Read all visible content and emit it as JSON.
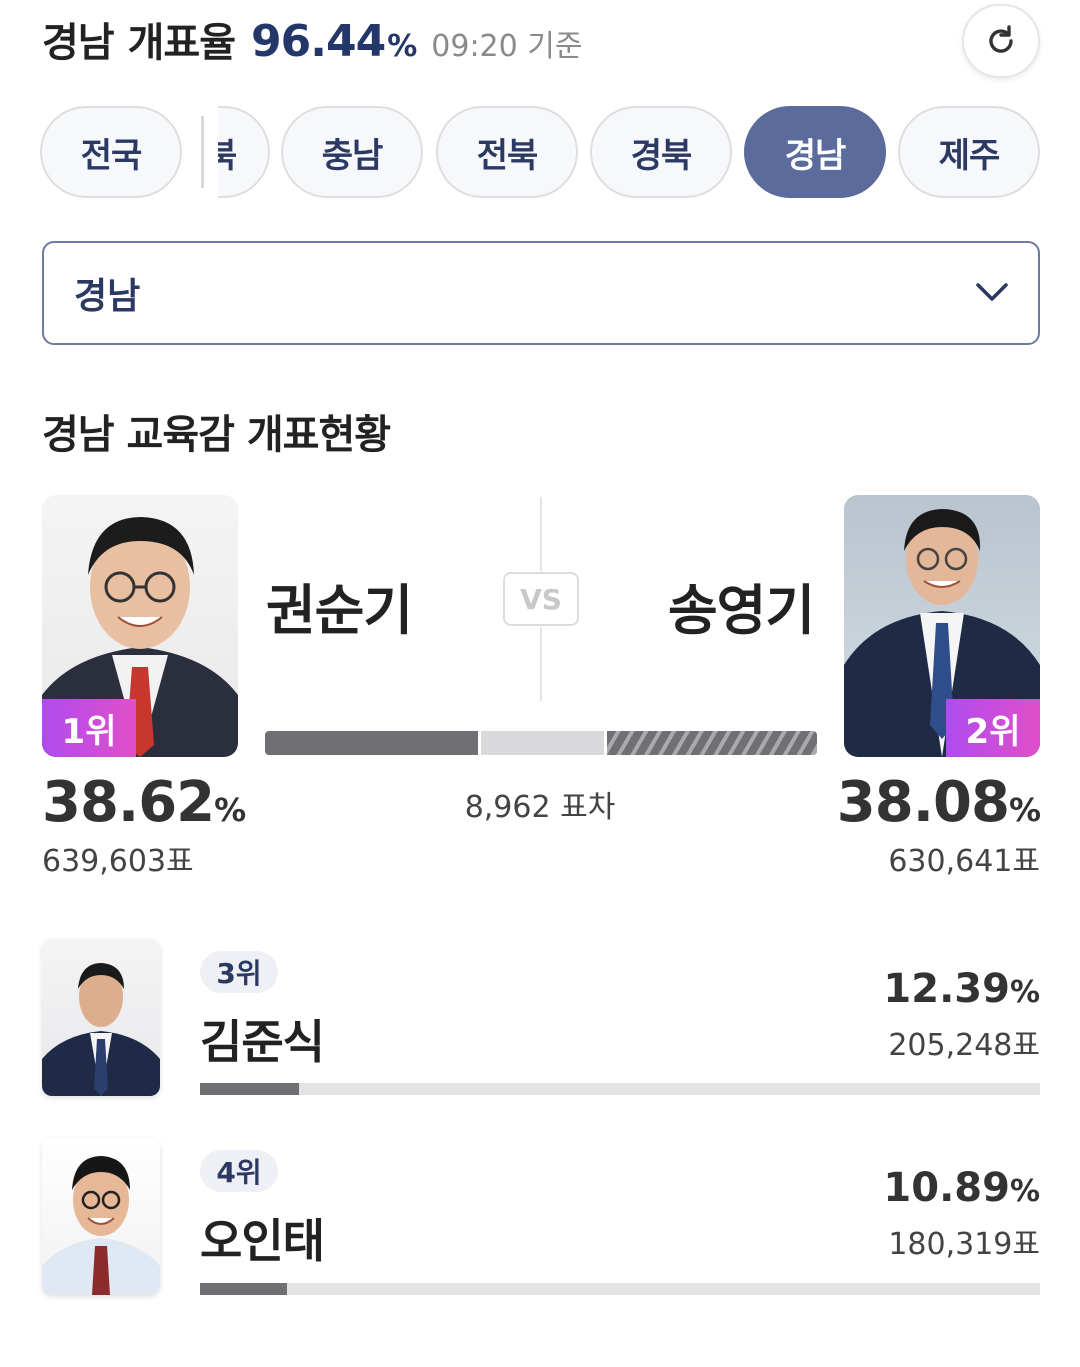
{
  "header": {
    "region": "경남",
    "label": "개표율",
    "rate": "96.44",
    "rate_unit": "%",
    "time": "09:20 기준"
  },
  "tabs": [
    {
      "label": "전국",
      "active": false
    },
    {
      "label": "북",
      "active": false
    },
    {
      "label": "충남",
      "active": false
    },
    {
      "label": "전북",
      "active": false
    },
    {
      "label": "경북",
      "active": false
    },
    {
      "label": "경남",
      "active": true
    },
    {
      "label": "제주",
      "active": false
    }
  ],
  "select": {
    "value": "경남"
  },
  "section_title": "경남 교육감 개표현황",
  "vs_label": "VS",
  "top": {
    "first": {
      "name": "권순기",
      "rank": "1위",
      "pct": "38.62",
      "unit": "%",
      "votes": "639,603표",
      "share": 0.3862
    },
    "second": {
      "name": "송영기",
      "rank": "2위",
      "pct": "38.08",
      "unit": "%",
      "votes": "630,641표",
      "share": 0.3808
    },
    "diff": "8,962 표차"
  },
  "others": [
    {
      "rank": "3위",
      "name": "김준식",
      "pct": "12.39",
      "unit": "%",
      "votes": "205,248표",
      "share": 0.1239
    },
    {
      "rank": "4위",
      "name": "오인태",
      "pct": "10.89",
      "unit": "%",
      "votes": "180,319표",
      "share": 0.1089
    }
  ],
  "colors": {
    "navy": "#24376b",
    "active_tab": "#5b6b9c",
    "badge_from": "#b04bf0",
    "badge_to": "#e04fc8"
  },
  "icons": [
    "refresh-icon",
    "chevron-down-icon"
  ]
}
